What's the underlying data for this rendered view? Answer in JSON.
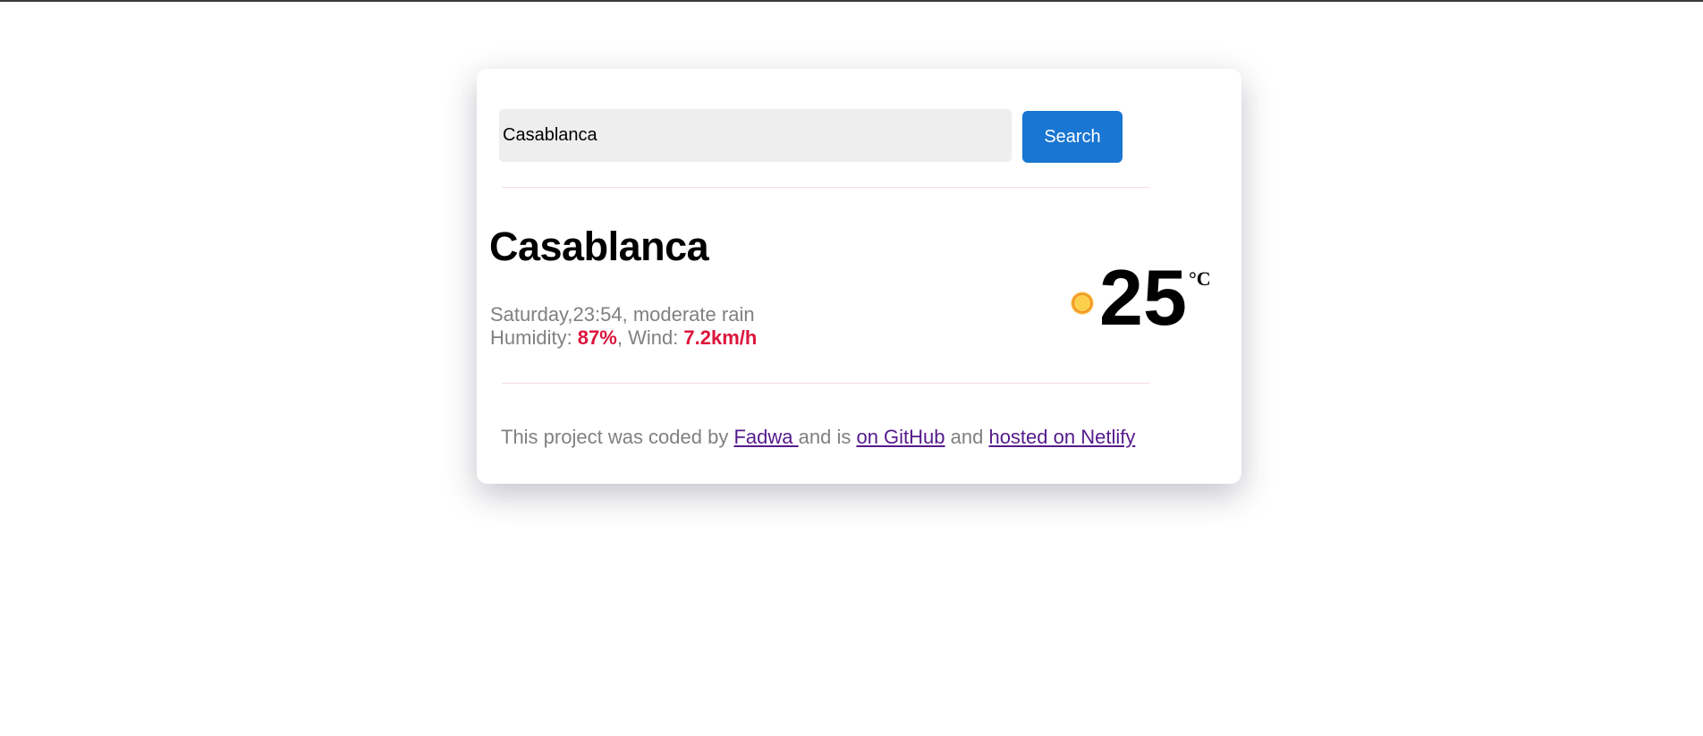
{
  "search": {
    "value": "Casablanca",
    "button_label": "Search"
  },
  "weather": {
    "city": "Casablanca",
    "day_time": "Saturday,23:54",
    "sep1": ", ",
    "description": "moderate rain",
    "humidity_label": "Humidity: ",
    "humidity_value": "87%",
    "wind_label": ", Wind: ",
    "wind_value": "7.2km/h",
    "temperature": "25",
    "unit": "°C",
    "icon": "sun-icon"
  },
  "footer": {
    "text_before": "This project was coded by ",
    "author_link": "Fadwa ",
    "text_middle": "and is ",
    "github_link": "on GitHub",
    "text_and": " and ",
    "netlify_link": "hosted on Netlify"
  },
  "colors": {
    "accent": "#1976d2",
    "highlight": "#dc143c",
    "muted": "#808080",
    "link": "#551a8b"
  }
}
